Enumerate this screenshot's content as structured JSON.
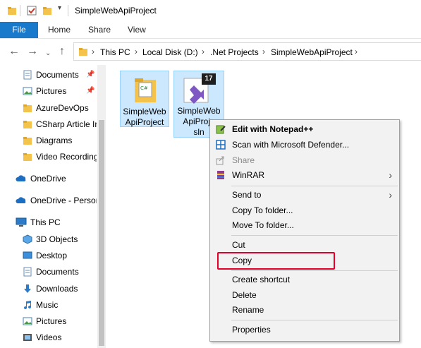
{
  "window": {
    "title": "SimpleWebApiProject"
  },
  "ribbon": {
    "tabs": [
      "File",
      "Home",
      "Share",
      "View"
    ]
  },
  "address": {
    "breadcrumbs": [
      "This PC",
      "Local Disk (D:)",
      ".Net Projects",
      "SimpleWebApiProject"
    ]
  },
  "nav": {
    "quick_access": [
      "Documents",
      "Pictures",
      "AzureDevOps",
      "CSharp Article Ir",
      "Diagrams",
      "Video Recording"
    ],
    "onedrive": "OneDrive",
    "onedrive_personal": "OneDrive - Persor",
    "this_pc": "This PC",
    "this_pc_items": [
      "3D Objects",
      "Desktop",
      "Documents",
      "Downloads",
      "Music",
      "Pictures",
      "Videos"
    ]
  },
  "files": [
    {
      "name_line1": "SimpleWeb",
      "name_line2": "ApiProject",
      "icon": "folder-icon"
    },
    {
      "name_line1": "SimpleWeb",
      "name_line2": "ApiProje",
      "name_line3": "sln",
      "icon": "visual-studio-solution-icon",
      "badge": "17"
    }
  ],
  "context_menu": {
    "edit_notepad": "Edit with Notepad++",
    "scan_defender": "Scan with Microsoft Defender...",
    "share": "Share",
    "winrar": "WinRAR",
    "send_to": "Send to",
    "copy_to_folder": "Copy To folder...",
    "move_to_folder": "Move To folder...",
    "cut": "Cut",
    "copy": "Copy",
    "create_shortcut": "Create shortcut",
    "delete": "Delete",
    "rename": "Rename",
    "properties": "Properties"
  },
  "colors": {
    "accent": "#1979ca",
    "selection": "#cce8ff",
    "highlight_box": "#e4002b"
  }
}
